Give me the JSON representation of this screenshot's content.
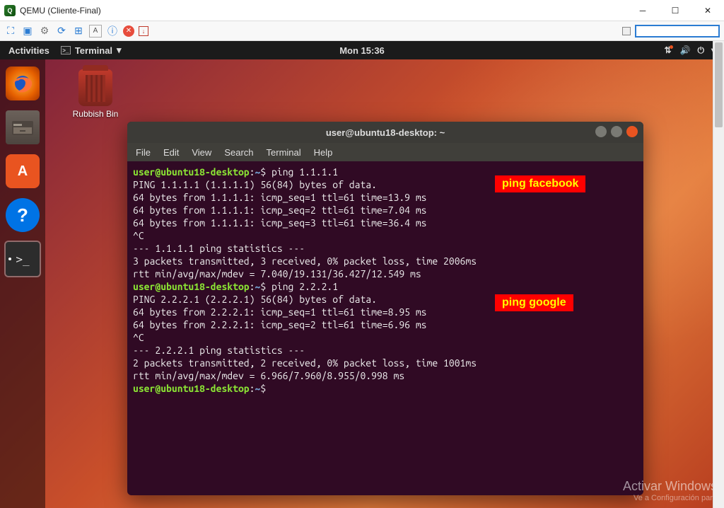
{
  "window": {
    "title": "QEMU (Cliente-Final)",
    "min_tip": "Minimize",
    "max_tip": "Maximize",
    "close_tip": "Close"
  },
  "qemu_toolbar": {
    "icons": [
      "monitor",
      "fullscreen",
      "gear",
      "refresh",
      "windows",
      "keyboard",
      "info",
      "stop",
      "capture"
    ]
  },
  "gnome": {
    "activities": "Activities",
    "app_menu": "Terminal",
    "clock": "Mon 15:36"
  },
  "dock": {
    "items": [
      "firefox",
      "files",
      "software",
      "help",
      "terminal"
    ]
  },
  "desktop": {
    "trash_label": "Rubbish Bin"
  },
  "terminal": {
    "title": "user@ubuntu18-desktop: ~",
    "menu": [
      "File",
      "Edit",
      "View",
      "Search",
      "Terminal",
      "Help"
    ],
    "prompt_user": "user@ubuntu18-desktop",
    "prompt_path": "~",
    "lines": [
      {
        "type": "prompt",
        "cmd": "ping 1.1.1.1"
      },
      {
        "type": "out",
        "text": "PING 1.1.1.1 (1.1.1.1) 56(84) bytes of data."
      },
      {
        "type": "out",
        "text": "64 bytes from 1.1.1.1: icmp_seq=1 ttl=61 time=13.9 ms"
      },
      {
        "type": "out",
        "text": "64 bytes from 1.1.1.1: icmp_seq=2 ttl=61 time=7.04 ms"
      },
      {
        "type": "out",
        "text": "64 bytes from 1.1.1.1: icmp_seq=3 ttl=61 time=36.4 ms"
      },
      {
        "type": "out",
        "text": "^C"
      },
      {
        "type": "out",
        "text": "--- 1.1.1.1 ping statistics ---"
      },
      {
        "type": "out",
        "text": "3 packets transmitted, 3 received, 0% packet loss, time 2006ms"
      },
      {
        "type": "out",
        "text": "rtt min/avg/max/mdev = 7.040/19.131/36.427/12.549 ms"
      },
      {
        "type": "prompt",
        "cmd": "ping 2.2.2.1"
      },
      {
        "type": "out",
        "text": "PING 2.2.2.1 (2.2.2.1) 56(84) bytes of data."
      },
      {
        "type": "out",
        "text": "64 bytes from 2.2.2.1: icmp_seq=1 ttl=61 time=8.95 ms"
      },
      {
        "type": "out",
        "text": "64 bytes from 2.2.2.1: icmp_seq=2 ttl=61 time=6.96 ms"
      },
      {
        "type": "out",
        "text": "^C"
      },
      {
        "type": "out",
        "text": "--- 2.2.2.1 ping statistics ---"
      },
      {
        "type": "out",
        "text": "2 packets transmitted, 2 received, 0% packet loss, time 1001ms"
      },
      {
        "type": "out",
        "text": "rtt min/avg/max/mdev = 6.966/7.960/8.955/0.998 ms"
      },
      {
        "type": "prompt",
        "cmd": ""
      }
    ]
  },
  "annotations": {
    "a1": "ping facebook",
    "a2": "ping google"
  },
  "watermark": {
    "line1": "Activar Windows",
    "line2": "Ve a Configuración para"
  }
}
